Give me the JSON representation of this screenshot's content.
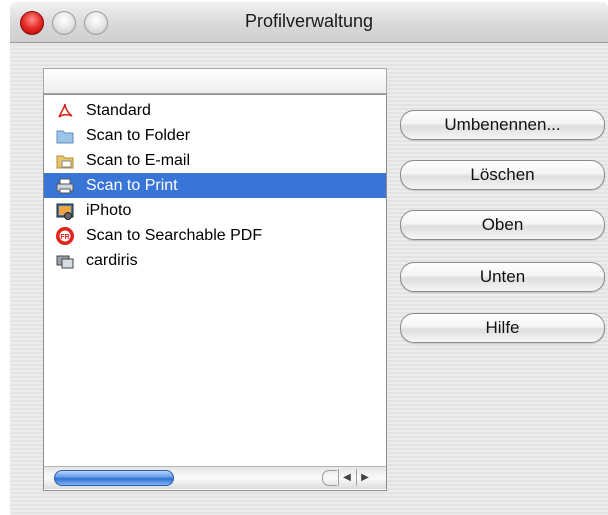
{
  "window": {
    "title": "Profilverwaltung"
  },
  "list": {
    "header": "",
    "items": [
      {
        "label": "Standard",
        "icon": "acrobat-icon",
        "selected": false
      },
      {
        "label": "Scan to Folder",
        "icon": "folder-icon",
        "selected": false
      },
      {
        "label": "Scan to E-mail",
        "icon": "email-icon",
        "selected": false
      },
      {
        "label": "Scan to Print",
        "icon": "printer-icon",
        "selected": true
      },
      {
        "label": "iPhoto",
        "icon": "iphoto-icon",
        "selected": false
      },
      {
        "label": "Scan to Searchable PDF",
        "icon": "searchable-pdf-icon",
        "selected": false
      },
      {
        "label": "cardiris",
        "icon": "cardiris-icon",
        "selected": false
      }
    ]
  },
  "buttons": {
    "rename": "Umbenennen...",
    "delete": "Löschen",
    "up": "Oben",
    "down": "Unten",
    "help": "Hilfe"
  },
  "colors": {
    "selection": "#3875d7",
    "close_button": "#e2221d"
  }
}
